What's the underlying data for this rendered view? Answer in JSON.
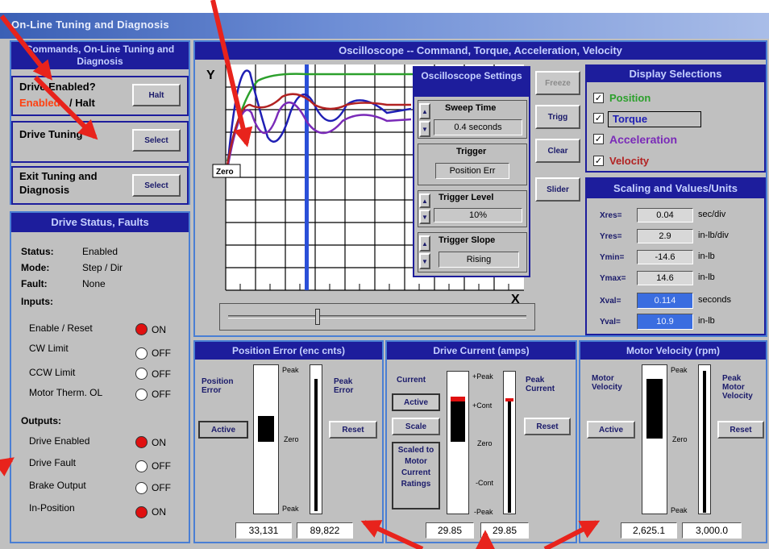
{
  "window": {
    "title": "On-Line Tuning and Diagnosis"
  },
  "commands": {
    "header": "Commands, On-Line Tuning and Diagnosis",
    "drive_enabled_q": "Drive Enabled?",
    "enabled_word": "Enabled",
    "halt_word": "/ Halt",
    "halt_button": "Halt",
    "drive_tuning": "Drive Tuning",
    "select_button": "Select",
    "exit_tuning": "Exit Tuning and Diagnosis",
    "select_button_2": "Select"
  },
  "status": {
    "header": "Drive Status, Faults",
    "status_label": "Status:",
    "status_value": "Enabled",
    "mode_label": "Mode:",
    "mode_value": "Step / Dir",
    "fault_label": "Fault:",
    "fault_value": "None",
    "inputs_label": "Inputs:",
    "inputs": [
      {
        "label": "Enable / Reset",
        "state": "ON",
        "color": "#e01010"
      },
      {
        "label": "CW Limit",
        "state": "OFF",
        "color": "#ffffff"
      },
      {
        "label": "CCW Limit",
        "state": "OFF",
        "color": "#ffffff"
      },
      {
        "label": "Motor Therm. OL",
        "state": "OFF",
        "color": "#ffffff"
      }
    ],
    "outputs_label": "Outputs:",
    "outputs": [
      {
        "label": "Drive Enabled",
        "state": "ON",
        "color": "#e01010"
      },
      {
        "label": "Drive Fault",
        "state": "OFF",
        "color": "#ffffff"
      },
      {
        "label": "Brake Output",
        "state": "OFF",
        "color": "#ffffff"
      },
      {
        "label": "In-Position",
        "state": "ON",
        "color": "#e01010"
      }
    ]
  },
  "scope": {
    "header": "Oscilloscope -- Command, Torque, Acceleration, Velocity",
    "y_label": "Y",
    "x_label": "X",
    "zero_label": "Zero",
    "settings_header": "Oscilloscope Settings",
    "sweep_time_label": "Sweep Time",
    "sweep_time_value": "0.4 seconds",
    "trigger_label": "Trigger",
    "trigger_value": "Position Err",
    "trigger_level_label": "Trigger Level",
    "trigger_level_value": "10%",
    "trigger_slope_label": "Trigger Slope",
    "trigger_slope_value": "Rising",
    "buttons": {
      "freeze": "Freeze",
      "trigg": "Trigg",
      "clear": "Clear",
      "slider": "Slider"
    }
  },
  "display": {
    "header": "Display Selections",
    "items": [
      {
        "label": "Position",
        "color": "#2ca02c",
        "checked": "✓"
      },
      {
        "label": "Torque",
        "color": "#1f1fb4",
        "checked": "✓"
      },
      {
        "label": "Acceleration",
        "color": "#7a2ab8",
        "checked": "✓"
      },
      {
        "label": "Velocity",
        "color": "#b22222",
        "checked": "✓"
      }
    ]
  },
  "scaling": {
    "header": "Scaling and Values/Units",
    "rows": [
      {
        "label": "Xres=",
        "value": "0.04",
        "unit": "sec/div"
      },
      {
        "label": "Yres=",
        "value": "2.9",
        "unit": "in-lb/div"
      },
      {
        "label": "Ymin=",
        "value": "-14.6",
        "unit": "in-lb"
      },
      {
        "label": "Ymax=",
        "value": "14.6",
        "unit": "in-lb"
      },
      {
        "label": "Xval=",
        "value": "0.114",
        "unit": "seconds"
      },
      {
        "label": "Yval=",
        "value": "10.9",
        "unit": "in-lb"
      }
    ]
  },
  "position_error": {
    "header": "Position Error (enc cnts)",
    "left_label": "Position Error",
    "right_label": "Peak Error",
    "active": "Active",
    "reset": "Reset",
    "peak_top": "Peak",
    "zero": "Zero",
    "peak_bottom": "Peak",
    "value": "33,131",
    "peak_value": "89,822"
  },
  "drive_current": {
    "header": "Drive Current (amps)",
    "left_label": "Current",
    "right_label": "Peak Current",
    "active": "Active",
    "scale": "Scale",
    "scaled_note": "Scaled to Motor Current Ratings",
    "reset": "Reset",
    "peak_top": "+Peak",
    "cont_top": "+Cont",
    "zero": "Zero",
    "cont_bottom": "-Cont",
    "peak_bottom": "-Peak",
    "value": "29.85",
    "peak_value": "29.85"
  },
  "motor_velocity": {
    "header": "Motor Velocity (rpm)",
    "left_label": "Motor Velocity",
    "right_label": "Peak Motor Velocity",
    "active": "Active",
    "reset": "Reset",
    "peak_top": "Peak",
    "zero": "Zero",
    "peak_bottom": "Peak",
    "value": "2,625.1",
    "peak_value": "3,000.0"
  }
}
